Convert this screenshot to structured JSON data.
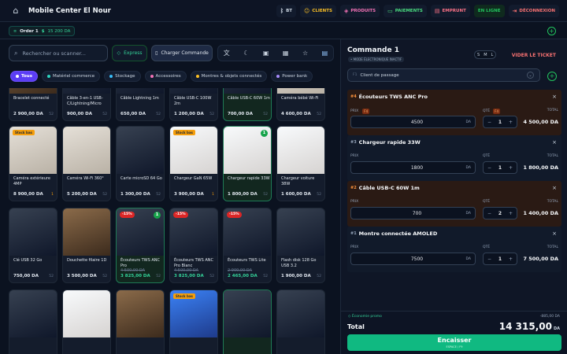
{
  "header": {
    "title": "Mobile Center El Nour",
    "nav": [
      {
        "label": "BT",
        "icon": "bluetooth-icon",
        "color": "#cbd5e1"
      },
      {
        "label": "CLIENTS",
        "icon": "users-icon",
        "color": "#fbbf24"
      },
      {
        "label": "PRODUITS",
        "icon": "box-icon",
        "color": "#f472b6"
      },
      {
        "label": "PAIEMENTS",
        "icon": "card-icon",
        "color": "#4ade80"
      },
      {
        "label": "EMPRUNT",
        "icon": "loan-icon",
        "color": "#fb7185"
      },
      {
        "label": "EN LIGNE",
        "icon": "",
        "color": "#22c55e"
      },
      {
        "label": "DÉCONNEXION",
        "icon": "logout-icon",
        "color": "#f87171"
      }
    ]
  },
  "orders_bar": {
    "order_label": "Order 1",
    "currency_symbol": "$",
    "amount": "15 200 DA"
  },
  "toolbar": {
    "search_placeholder": "Rechercher ou scanner...",
    "express_label": "Express",
    "charger_label": "Charger Commande"
  },
  "categories": [
    {
      "label": "Tous",
      "active": true,
      "color": "#ffffff"
    },
    {
      "label": "Matériel commerce",
      "color": "#2dd4bf"
    },
    {
      "label": "Stockage",
      "color": "#38bdf8"
    },
    {
      "label": "Accessoires",
      "color": "#f472b6"
    },
    {
      "label": "Montres & objets connectés",
      "color": "#fbbf24"
    },
    {
      "label": "Power bank",
      "color": "#a78bfa"
    }
  ],
  "products_row0": [
    {
      "name": "Bracelet connecté",
      "price": "2 900,00 DA",
      "stock": "52"
    },
    {
      "name": "Câble 3-en-1 USB-C/Lightning/Micro",
      "price": "900,00 DA",
      "stock": "52"
    },
    {
      "name": "Câble Lightning 1m",
      "price": "650,00 DA",
      "stock": "52"
    },
    {
      "name": "Câble USB-C 100W 2m",
      "price": "1 200,00 DA",
      "stock": "52"
    },
    {
      "name": "Câble USB-C 60W 1m",
      "price": "700,00 DA",
      "stock": "52"
    },
    {
      "name": "Caméra bébé Wi-Fi",
      "price": "4 600,00 DA",
      "stock": "52"
    }
  ],
  "products_row1": [
    {
      "name": "Caméra extérieure 4MP",
      "price": "8 900,00 DA",
      "stock": "1",
      "badge": "Stock bas"
    },
    {
      "name": "Caméra Wi-Fi 360°",
      "price": "5 200,00 DA",
      "stock": "52"
    },
    {
      "name": "Carte microSD 64 Go",
      "price": "1 300,00 DA",
      "stock": "52"
    },
    {
      "name": "Chargeur GaN 65W",
      "price": "3 900,00 DA",
      "stock": "1",
      "badge": "Stock bas"
    },
    {
      "name": "Chargeur rapide 33W",
      "price": "1 800,00 DA",
      "stock": "52",
      "count": "1"
    },
    {
      "name": "Chargeur voiture 38W",
      "price": "1 600,00 DA",
      "stock": "52"
    }
  ],
  "products_row2": [
    {
      "name": "Clé USB 32 Go",
      "price": "750,00 DA",
      "stock": "52"
    },
    {
      "name": "Douchette filaire 1D",
      "price": "3 500,00 DA",
      "stock": "52"
    },
    {
      "name": "Écouteurs TWS ANC Pro",
      "old": "4 500,00 DA",
      "price": "3 825,00 DA",
      "stock": "52",
      "pct": "-15%",
      "count": "1"
    },
    {
      "name": "Écouteurs TWS ANC Pro Blanc",
      "old": "4 500,00 DA",
      "price": "3 825,00 DA",
      "stock": "52",
      "pct": "-15%"
    },
    {
      "name": "Écouteurs TWS Lite",
      "old": "2 900,00 DA",
      "price": "2 465,00 DA",
      "stock": "52",
      "pct": "-15%"
    },
    {
      "name": "Flash disk 128 Go USB 3.2",
      "price": "1 900,00 DA",
      "stock": "52"
    }
  ],
  "products_row3": [
    {
      "name": ""
    },
    {
      "name": ""
    },
    {
      "name": ""
    },
    {
      "name": "",
      "badge": "Stock bas"
    },
    {
      "name": ""
    },
    {
      "name": ""
    }
  ],
  "order": {
    "title": "Commande 1",
    "subtitle": "• MODE ÉLECTRONIQUE INACTIF",
    "sizes": [
      "S",
      "M",
      "L"
    ],
    "clear_label": "VIDER LE TICKET",
    "client_prefix": "F1",
    "client_label": "Client de passage",
    "prix_label": "PRIX",
    "qte_label": "QTÉ",
    "total_label": "TOTAL",
    "currency": "DA",
    "items": [
      {
        "num": "#4",
        "name": "Écouteurs TWS ANC Pro",
        "price": "4500",
        "qty": "1",
        "total": "4 500,00 DA",
        "badge_prix": "F4",
        "badge_qte": "F4",
        "highlight": true
      },
      {
        "num": "#3",
        "name": "Chargeur rapide 33W",
        "price": "1800",
        "qty": "1",
        "total": "1 800,00 DA",
        "badge_prix": "",
        "badge_qte": "",
        "highlight": false
      },
      {
        "num": "#2",
        "name": "Câble USB-C 60W 1m",
        "price": "700",
        "qty": "2",
        "total": "1 400,00 DA",
        "badge_prix": "",
        "badge_qte": "",
        "highlight": true
      },
      {
        "num": "#1",
        "name": "Montre connectée AMOLED",
        "price": "7500",
        "qty": "1",
        "total": "7 500,00 DA",
        "badge_prix": "",
        "badge_qte": "",
        "highlight": false
      }
    ],
    "economy_label": "Économie promo",
    "economy_value": "-885,00 DA",
    "total_text": "Total",
    "grand_total": "14 315,00",
    "grand_currency": "DA",
    "pay_label": "Encaisser",
    "pay_hint": "ESPACE / F9"
  }
}
